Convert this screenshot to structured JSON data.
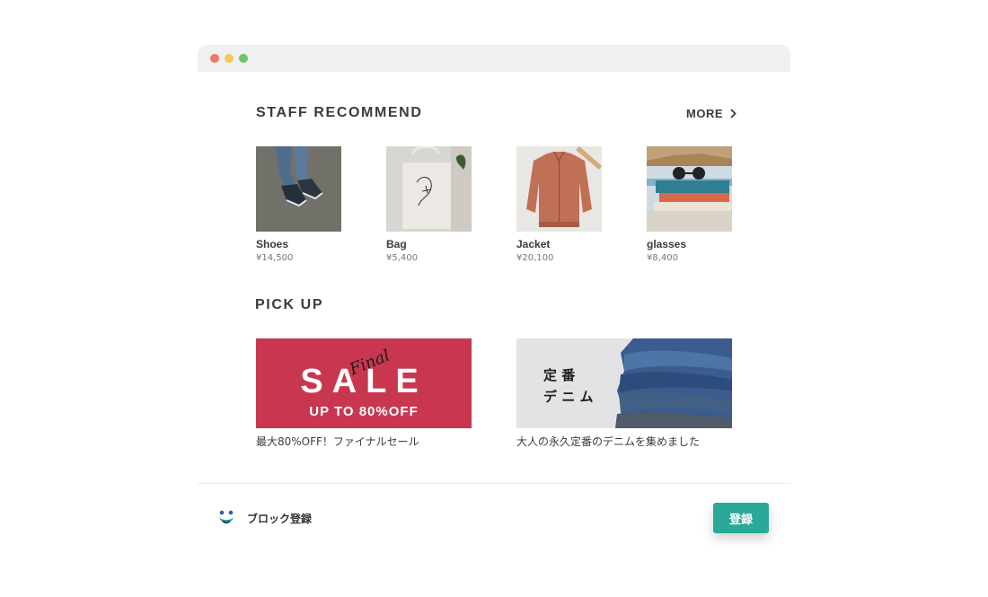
{
  "staff": {
    "title": "STAFF RECOMMEND",
    "more_label": "MORE",
    "products": [
      {
        "name": "Shoes",
        "price": "¥14,500"
      },
      {
        "name": "Bag",
        "price": "¥5,400"
      },
      {
        "name": "Jacket",
        "price": "¥20,100"
      },
      {
        "name": "glasses",
        "price": "¥8,400"
      }
    ]
  },
  "pickup": {
    "title": "PICK UP",
    "banners": [
      {
        "final_text": "Final",
        "sale_text": "SALE",
        "sub_text": "UP TO 80%OFF",
        "caption": "最大80%OFF！ファイナルセール",
        "bg_color": "#c8374f"
      },
      {
        "line1": "定 番",
        "line2": "デ ニ ム",
        "caption": "大人の永久定番のデニムを集めました"
      }
    ]
  },
  "footer": {
    "label": "ブロック登録",
    "register_label": "登録",
    "accent": "#2aa89a"
  },
  "window_controls": [
    "close",
    "minimize",
    "maximize"
  ]
}
